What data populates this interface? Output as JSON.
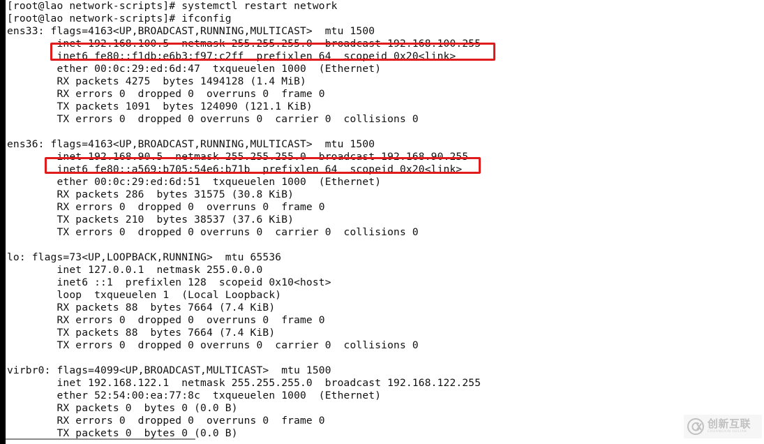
{
  "terminal": {
    "prompt": "[root@lao network-scripts]#",
    "hostname": "lao",
    "user": "root",
    "cwd": "network-scripts",
    "commands": [
      "systemctl restart network",
      "ifconfig"
    ],
    "lines": [
      "[root@lao network-scripts]# systemctl restart network",
      "[root@lao network-scripts]# ifconfig",
      "ens33: flags=4163<UP,BROADCAST,RUNNING,MULTICAST>  mtu 1500",
      "        inet 192.168.100.5  netmask 255.255.255.0  broadcast 192.168.100.255",
      "        inet6 fe80::f1db:e6b3:f97:c2ff  prefixlen 64  scopeid 0x20<link>",
      "        ether 00:0c:29:ed:6d:47  txqueuelen 1000  (Ethernet)",
      "        RX packets 4275  bytes 1494128 (1.4 MiB)",
      "        RX errors 0  dropped 0  overruns 0  frame 0",
      "        TX packets 1091  bytes 124090 (121.1 KiB)",
      "        TX errors 0  dropped 0 overruns 0  carrier 0  collisions 0",
      "",
      "ens36: flags=4163<UP,BROADCAST,RUNNING,MULTICAST>  mtu 1500",
      "        inet 192.168.90.5  netmask 255.255.255.0  broadcast 192.168.90.255",
      "        inet6 fe80::a569:b705:54e6:b71b  prefixlen 64  scopeid 0x20<link>",
      "        ether 00:0c:29:ed:6d:51  txqueuelen 1000  (Ethernet)",
      "        RX packets 286  bytes 31575 (30.8 KiB)",
      "        RX errors 0  dropped 0  overruns 0  frame 0",
      "        TX packets 210  bytes 38537 (37.6 KiB)",
      "        TX errors 0  dropped 0 overruns 0  carrier 0  collisions 0",
      "",
      "lo: flags=73<UP,LOOPBACK,RUNNING>  mtu 65536",
      "        inet 127.0.0.1  netmask 255.0.0.0",
      "        inet6 ::1  prefixlen 128  scopeid 0x10<host>",
      "        loop  txqueuelen 1  (Local Loopback)",
      "        RX packets 88  bytes 7664 (7.4 KiB)",
      "        RX errors 0  dropped 0  overruns 0  frame 0",
      "        TX packets 88  bytes 7664 (7.4 KiB)",
      "        TX errors 0  dropped 0 overruns 0  carrier 0  collisions 0",
      "",
      "virbr0: flags=4099<UP,BROADCAST,MULTICAST>  mtu 1500",
      "        inet 192.168.122.1  netmask 255.255.255.0  broadcast 192.168.122.255",
      "        ether 52:54:00:ea:77:8c  txqueuelen 1000  (Ethernet)",
      "        RX packets 0  bytes 0 (0.0 B)",
      "        RX errors 0  dropped 0  overruns 0  frame 0",
      "        TX packets 0  bytes 0 (0.0 B)"
    ]
  },
  "interfaces": [
    {
      "name": "ens33",
      "flags": "4163<UP,BROADCAST,RUNNING,MULTICAST>",
      "mtu": "1500",
      "inet": "192.168.100.5",
      "netmask": "255.255.255.0",
      "broadcast": "192.168.100.255",
      "inet6": "fe80::f1db:e6b3:f97:c2ff",
      "prefixlen": "64",
      "scopeid": "0x20<link>",
      "ether": "00:0c:29:ed:6d:47",
      "txqueuelen": "1000",
      "type": "(Ethernet)",
      "rx_packets": "4275",
      "rx_bytes": "1494128",
      "rx_bytes_human": "1.4 MiB",
      "tx_packets": "1091",
      "tx_bytes": "124090",
      "tx_bytes_human": "121.1 KiB",
      "highlighted": true
    },
    {
      "name": "ens36",
      "flags": "4163<UP,BROADCAST,RUNNING,MULTICAST>",
      "mtu": "1500",
      "inet": "192.168.90.5",
      "netmask": "255.255.255.0",
      "broadcast": "192.168.90.255",
      "inet6": "fe80::a569:b705:54e6:b71b",
      "prefixlen": "64",
      "scopeid": "0x20<link>",
      "ether": "00:0c:29:ed:6d:51",
      "txqueuelen": "1000",
      "type": "(Ethernet)",
      "rx_packets": "286",
      "rx_bytes": "31575",
      "rx_bytes_human": "30.8 KiB",
      "tx_packets": "210",
      "tx_bytes": "38537",
      "tx_bytes_human": "37.6 KiB",
      "highlighted": true
    },
    {
      "name": "lo",
      "flags": "73<UP,LOOPBACK,RUNNING>",
      "mtu": "65536",
      "inet": "127.0.0.1",
      "netmask": "255.0.0.0",
      "inet6": "::1",
      "prefixlen": "128",
      "scopeid": "0x10<host>",
      "txqueuelen": "1",
      "type": "(Local Loopback)",
      "rx_packets": "88",
      "rx_bytes": "7664",
      "rx_bytes_human": "7.4 KiB",
      "tx_packets": "88",
      "tx_bytes": "7664",
      "tx_bytes_human": "7.4 KiB",
      "highlighted": false
    },
    {
      "name": "virbr0",
      "flags": "4099<UP,BROADCAST,MULTICAST>",
      "mtu": "1500",
      "inet": "192.168.122.1",
      "netmask": "255.255.255.0",
      "broadcast": "192.168.122.255",
      "ether": "52:54:00:ea:77:8c",
      "txqueuelen": "1000",
      "type": "(Ethernet)",
      "rx_packets": "0",
      "rx_bytes": "0",
      "rx_bytes_human": "0.0 B",
      "tx_packets": "0",
      "tx_bytes": "0",
      "tx_bytes_human": "0.0 B",
      "highlighted": false
    }
  ],
  "annotations": {
    "highlight_color": "#e01b1b",
    "boxes": [
      {
        "target": "ens33-inet-line",
        "text": "inet 192.168.100.5  netmask 255.255.255.0  broadcast 192.168.100.255"
      },
      {
        "target": "ens36-inet-line",
        "text": "inet 192.168.90.5  netmask 255.255.255.0  broadcast 192.168.90.255"
      }
    ]
  },
  "watermark": {
    "cn": "创新互联",
    "en": "CHUANGXIN HULIAN"
  }
}
